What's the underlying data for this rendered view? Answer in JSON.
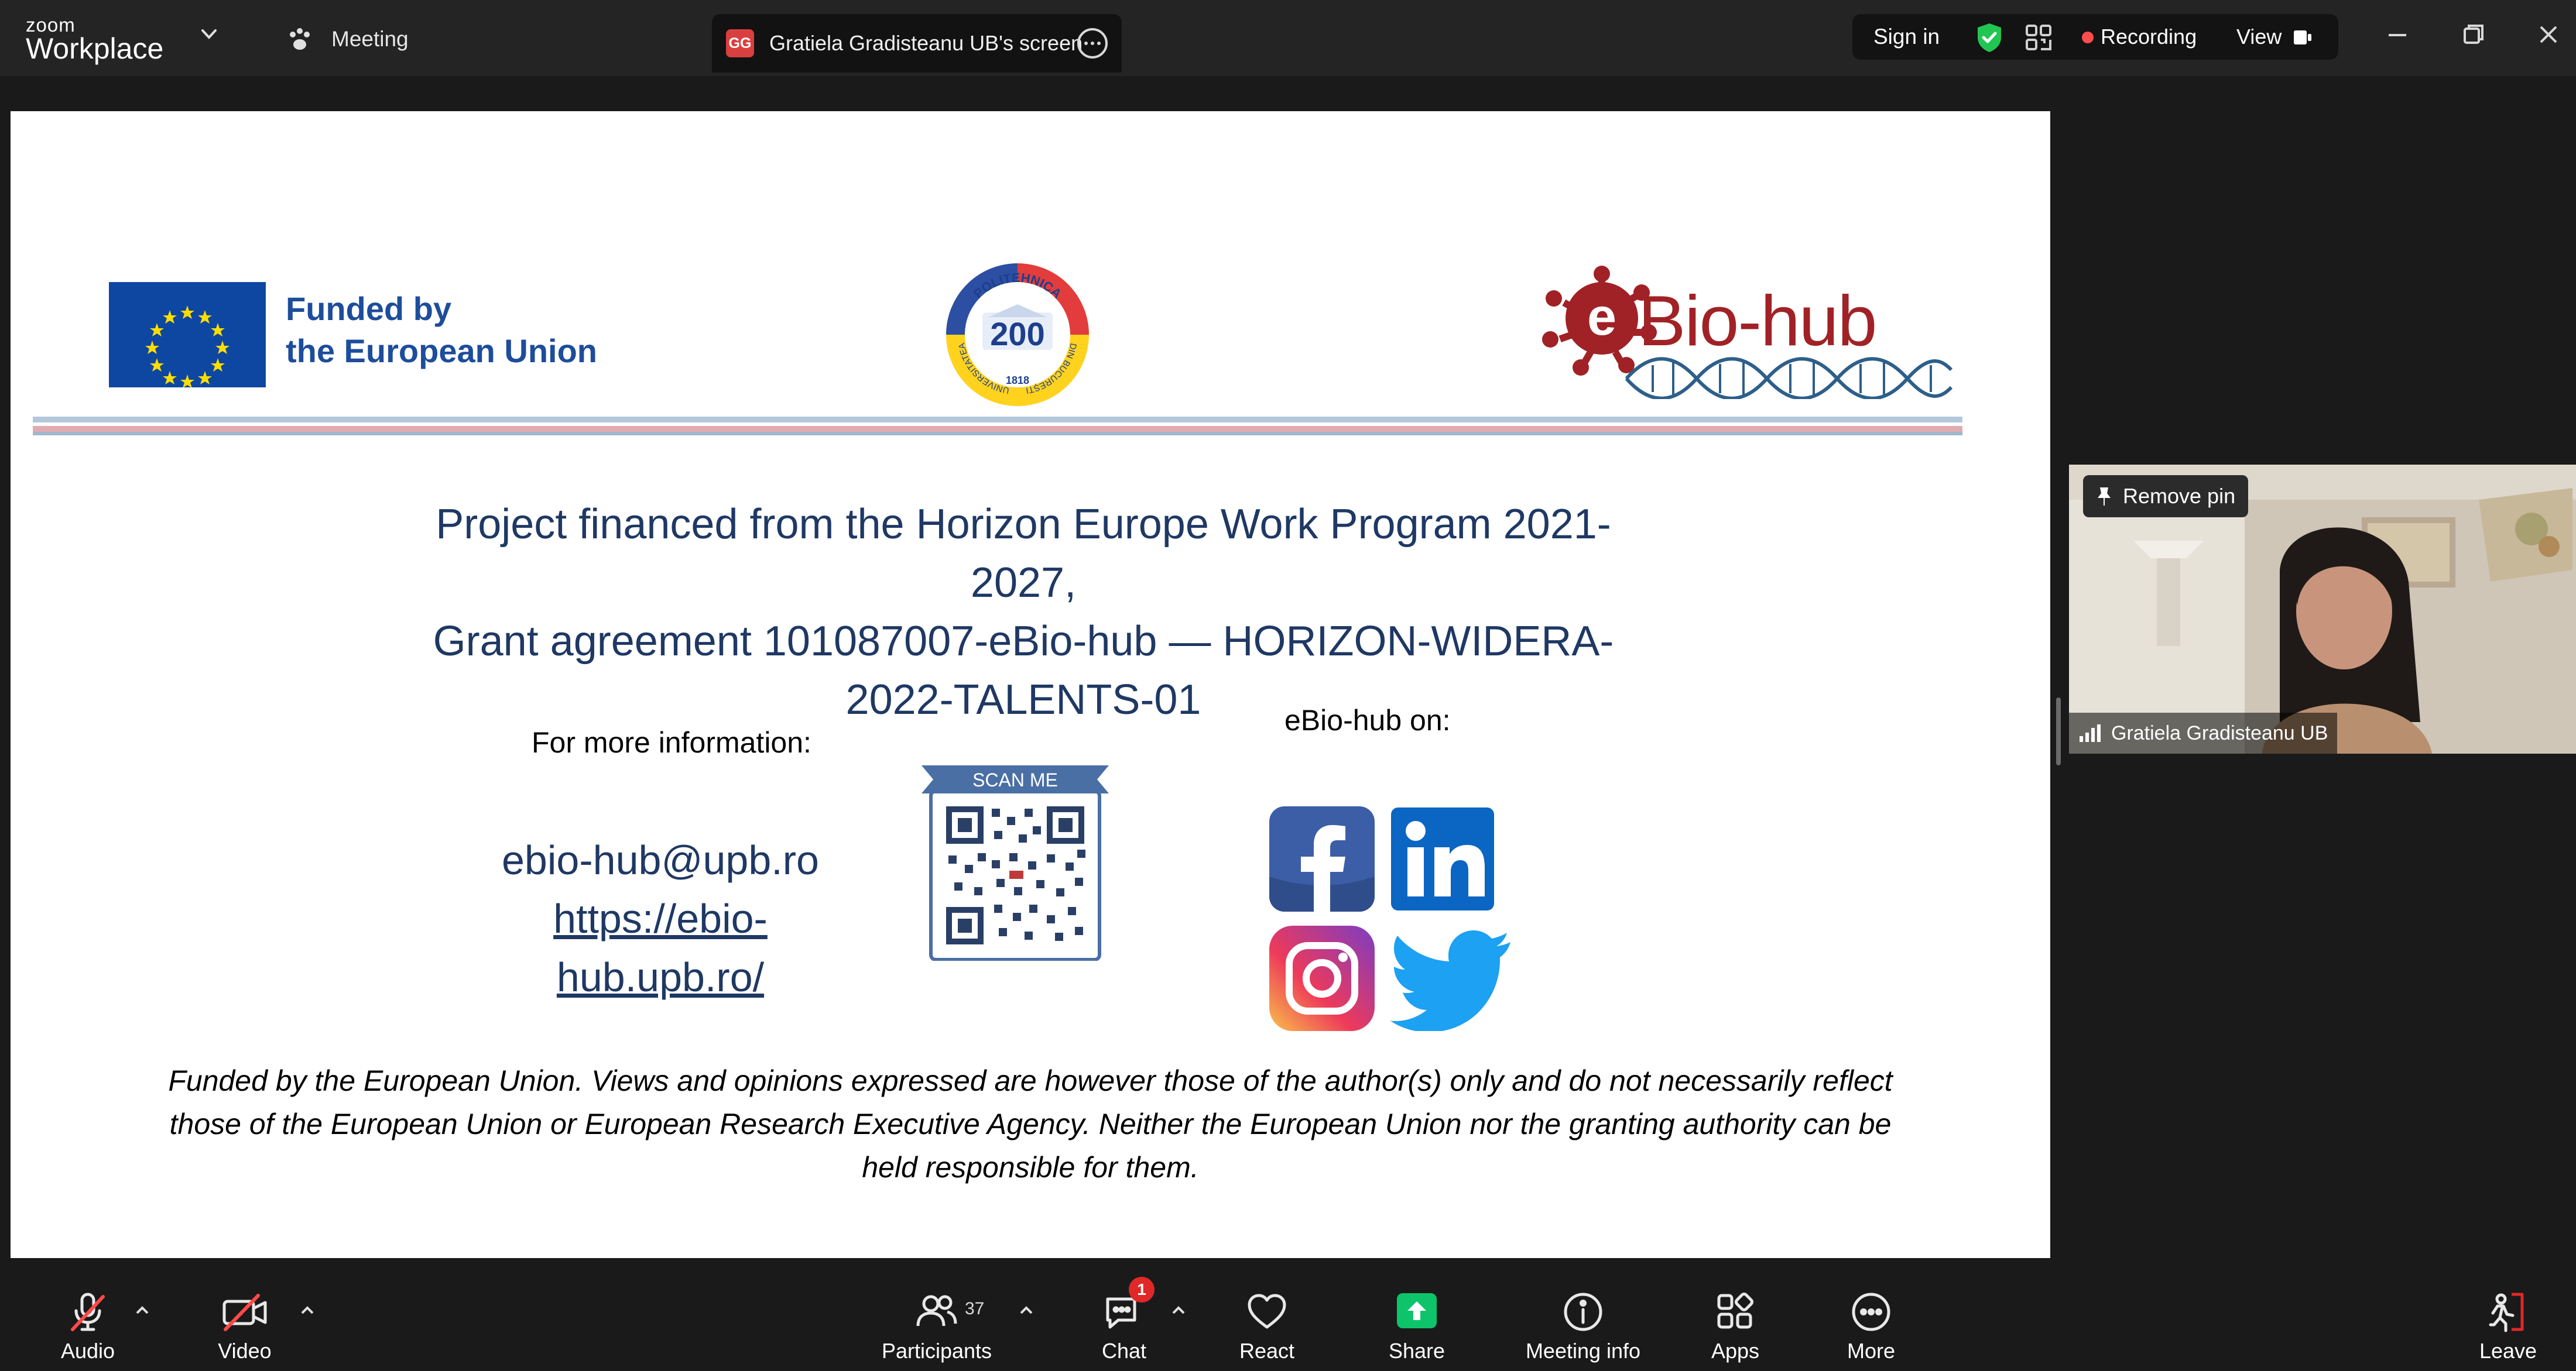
{
  "app": {
    "brand_small": "zoom",
    "brand_big": "Workplace",
    "meeting_tab_label": "Meeting",
    "share_tab": {
      "badge": "GG",
      "label": "Gratiela Gradisteanu UB's screen"
    },
    "sign_in": "Sign in",
    "recording": "Recording",
    "view": "View"
  },
  "slide": {
    "eu_text_line1": "Funded by",
    "eu_text_line2": "the European Union",
    "seal_top": "POLITEHNICA",
    "seal_left": "UNIVERSITATEA",
    "seal_right": "DIN BUCUREȘTI",
    "seal_center": "200",
    "seal_year": "1818",
    "logo_e": "e",
    "logo_text": "Bio-hub",
    "project_line1": "Project financed from the Horizon Europe Work Program 2021-",
    "project_line2": "2027,",
    "project_line3": "Grant agreement 101087007-eBio-hub — HORIZON-WIDERA-",
    "project_line4": "2022-TALENTS-01",
    "more_info_label": "For more information:",
    "ebio_on_label": "eBio-hub on:",
    "email": "ebio-hub@upb.ro",
    "url_line1": "https://ebio-",
    "url_line2": "hub.upb.ro/",
    "scan_me": "SCAN ME",
    "disclaimer_line1": "Funded by the European Union. Views and opinions expressed are however those of the author(s) only and do not necessarily reflect",
    "disclaimer_line2": "those of the European Union or European Research Executive Agency. Neither the European Union nor the granting authority can be",
    "disclaimer_line3": "held responsible for them."
  },
  "video": {
    "remove_pin": "Remove pin",
    "participant_name": "Gratiela Gradisteanu UB"
  },
  "toolbar": {
    "audio": "Audio",
    "video": "Video",
    "participants": "Participants",
    "participants_count": "37",
    "chat": "Chat",
    "chat_badge": "1",
    "react": "React",
    "share": "Share",
    "meeting_info": "Meeting info",
    "apps": "Apps",
    "more": "More",
    "leave": "Leave"
  },
  "colors": {
    "slide_text": "#1f3864",
    "eu_blue": "#0e47a1",
    "eu_yellow": "#ffdd00",
    "ebio_red": "#a02226",
    "ebio_blue": "#2d5f8a",
    "share_green": "#0dc46a",
    "record_red": "#ff4d4d",
    "leave_red": "#e02828"
  },
  "icons": [
    "chevron-down-icon",
    "paw-icon",
    "more-icon",
    "shield-check-icon",
    "qr-icon",
    "record-dot-icon",
    "view-icon",
    "minimize-icon",
    "restore-icon",
    "close-icon",
    "pin-icon",
    "signal-icon",
    "mic-off-icon",
    "video-off-icon",
    "participants-icon",
    "chat-icon",
    "heart-icon",
    "share-arrow-icon",
    "info-icon",
    "apps-icon",
    "more-circle-icon",
    "leave-icon",
    "facebook-icon",
    "linkedin-icon",
    "instagram-icon",
    "twitter-icon"
  ]
}
